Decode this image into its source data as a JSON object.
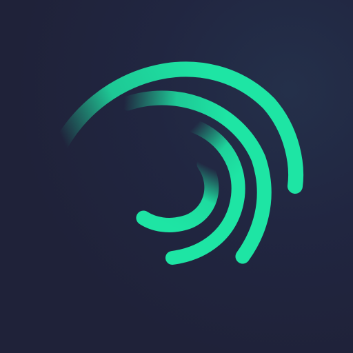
{
  "app_icon": {
    "background_color": "#1f2239",
    "accent_color": "#1ee5a4",
    "logo_icon": "swirl-spiral-icon"
  }
}
